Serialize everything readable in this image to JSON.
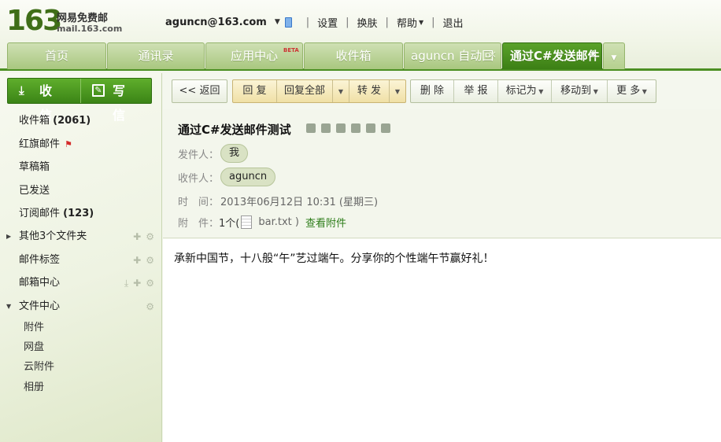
{
  "header": {
    "logo_number": "163",
    "logo_name": "网易免费邮",
    "logo_domain": "mail.163.com",
    "account": "aguncn@163.com",
    "links": [
      "设置",
      "换肤",
      "帮助",
      "退出"
    ]
  },
  "tabs": [
    {
      "label": "首页"
    },
    {
      "label": "通讯录"
    },
    {
      "label": "应用中心",
      "badge": "BETA"
    },
    {
      "label": "收件箱"
    },
    {
      "label": "aguncn 自动回"
    },
    {
      "label": "通过C#发送邮件"
    }
  ],
  "sidebar": {
    "receive_label": "收 信",
    "compose_label": "写 信",
    "folders": [
      {
        "label": "收件箱",
        "count": "(2061)"
      },
      {
        "label": "红旗邮件"
      },
      {
        "label": "草稿箱"
      },
      {
        "label": "已发送"
      },
      {
        "label": "订阅邮件",
        "count": "(123)"
      },
      {
        "label": "其他3个文件夹"
      },
      {
        "label": "邮件标签"
      },
      {
        "label": "邮箱中心"
      },
      {
        "label": "文件中心"
      }
    ],
    "file_center_items": [
      "附件",
      "网盘",
      "云附件",
      "相册"
    ]
  },
  "toolbar": {
    "back": "<< 返回",
    "reply": "回 复",
    "reply_all": "回复全部",
    "forward": "转 发",
    "delete": "删 除",
    "report": "举 报",
    "mark_as": "标记为",
    "move_to": "移动到",
    "more": "更 多"
  },
  "mail": {
    "subject": "通过C#发送邮件测试",
    "from_label": "发件人：",
    "from_value": "我",
    "to_label": "收件人：",
    "to_value": "aguncn",
    "time_label": "时　间：",
    "time_value": "2013年06月12日 10:31 (星期三)",
    "attach_label": "附　件：",
    "attach_count": "1个(",
    "attach_name": "bar.txt )",
    "view_attachments": "查看附件",
    "body": "承新中国节，十八般“午”艺过端午。分享你的个性端午节赢好礼！"
  }
}
